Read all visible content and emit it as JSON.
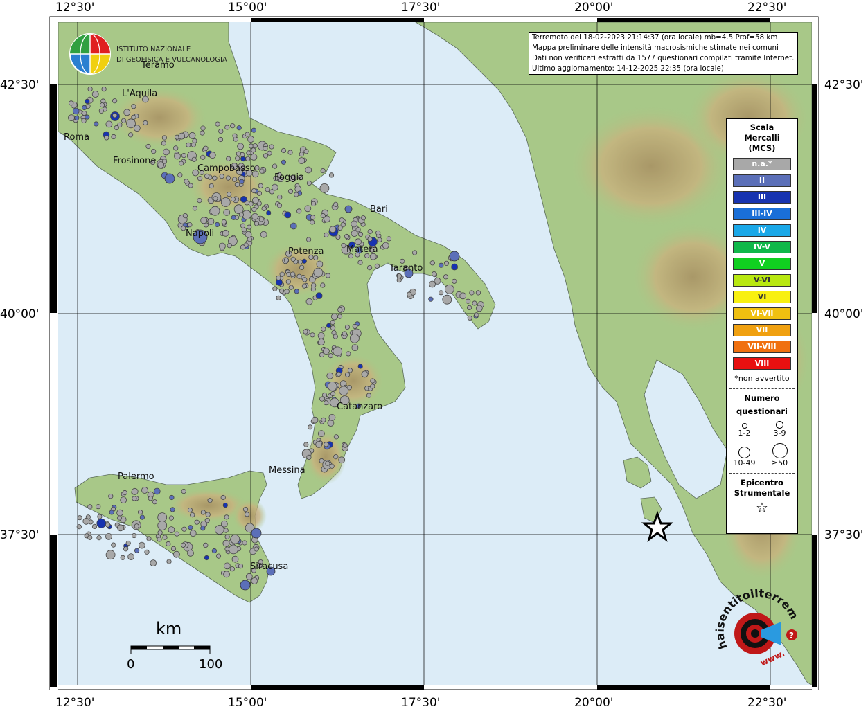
{
  "axes": {
    "lon_labels": [
      "12°30'",
      "15°00'",
      "17°30'",
      "20°00'",
      "22°30'"
    ],
    "lat_labels": [
      "42°30'",
      "40°00'",
      "37°30'"
    ]
  },
  "info": {
    "line1": "Terremoto del 18-02-2023 21:14:37 (ora locale) mb=4.5 Prof=58 km",
    "line2": "Mappa preliminare delle intensità macrosismiche stimate nei comuni",
    "line3": "Dati non verificati estratti da 1577 questionari compilati tramite Internet.",
    "line4": "Ultimo aggiornamento: 14-12-2025 22:35 (ora locale)"
  },
  "logo": {
    "line1": "ISTITUTO NAZIONALE",
    "line2": "DI GEOFISICA E VULCANOLOGIA"
  },
  "cities": [
    {
      "name": "Teramo"
    },
    {
      "name": "L'Aquila"
    },
    {
      "name": "Roma"
    },
    {
      "name": "Frosinone"
    },
    {
      "name": "Campobasso"
    },
    {
      "name": "Foggia"
    },
    {
      "name": "Bari"
    },
    {
      "name": "Napoli"
    },
    {
      "name": "Potenza"
    },
    {
      "name": "Matera"
    },
    {
      "name": "Taranto"
    },
    {
      "name": "Catanzaro"
    },
    {
      "name": "Messina"
    },
    {
      "name": "Palermo"
    },
    {
      "name": "Siracusa"
    }
  ],
  "legend": {
    "title1": "Scala",
    "title2": "Mercalli",
    "title3": "(MCS)",
    "scale": [
      {
        "label": "n.a.*",
        "color": "#a8a8a8"
      },
      {
        "label": "II",
        "color": "#5b6fb8"
      },
      {
        "label": "III",
        "color": "#1733b0"
      },
      {
        "label": "III-IV",
        "color": "#1a6fd8"
      },
      {
        "label": "IV",
        "color": "#1aa8e8"
      },
      {
        "label": "IV-V",
        "color": "#10b84a"
      },
      {
        "label": "V",
        "color": "#10d020"
      },
      {
        "label": "V-VI",
        "color": "#b8e810"
      },
      {
        "label": "VI",
        "color": "#f8f010"
      },
      {
        "label": "VI-VII",
        "color": "#f0c010"
      },
      {
        "label": "VII",
        "color": "#f0a010"
      },
      {
        "label": "VII-VIII",
        "color": "#f07010"
      },
      {
        "label": "VIII",
        "color": "#e81010"
      }
    ],
    "note": "*non avvertito",
    "count_title1": "Numero",
    "count_title2": "questionari",
    "sizes": [
      {
        "label": "1-2"
      },
      {
        "label": "3-9"
      },
      {
        "label": "10-49"
      },
      {
        "label": "≥50"
      }
    ],
    "epi_title1": "Epicentro",
    "epi_title2": "Strumentale"
  },
  "scalebar": {
    "unit": "km",
    "start": "0",
    "end": "100"
  },
  "badge": {
    "text": "haisentitoilterremoto.it",
    "www": "www."
  },
  "colors": {
    "sea": "#dcecf7",
    "land": "#a8c888",
    "highland": "#c9b27e",
    "mountain": "#a98c60",
    "grey_point": "#a8a8a8",
    "intensity_II": "#5b6fb8",
    "intensity_III": "#1733b0"
  }
}
